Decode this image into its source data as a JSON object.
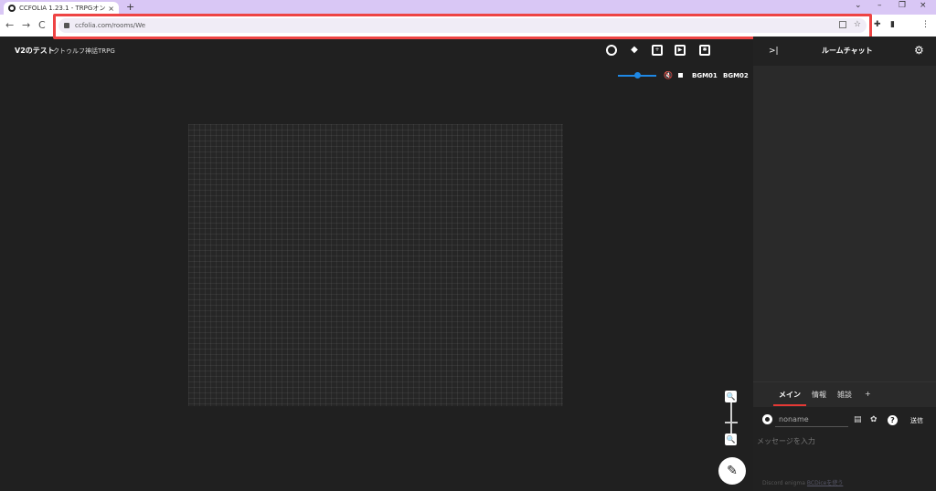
{
  "browser": {
    "tab_title": "CCFOLIA 1.23.1 - TRPGオンラインセ",
    "tab_close": "×",
    "new_tab": "+",
    "url": "ccfolia.com/rooms/We",
    "window": {
      "minimize": "–",
      "restore": "❐",
      "close": "×",
      "menu": "⌄"
    },
    "nav": {
      "back": "←",
      "forward": "→",
      "reload": "C"
    }
  },
  "room": {
    "title": "V2のテスト",
    "subtitle": "クトゥルフ神話TRPG"
  },
  "header_icons": [
    "face-icon",
    "layers-icon",
    "add-comment-icon",
    "screen-icon",
    "movie-icon"
  ],
  "audio": {
    "volume_percent": 50,
    "bgm1": "BGM01",
    "bgm2": "BGM02"
  },
  "chat": {
    "title": "ルームチャット",
    "tabs": [
      "メイン",
      "情報",
      "雑談"
    ],
    "add_tab": "+",
    "name_value": "noname",
    "message_placeholder": "メッセージを入力",
    "help": "?",
    "send_label": "送信",
    "footer_text": "Discord enigma",
    "footer_link": "BCDiceを使う"
  },
  "colors": {
    "accent": "#1e88e5",
    "tab_active": "#e53935",
    "highlight": "#ee4444"
  }
}
